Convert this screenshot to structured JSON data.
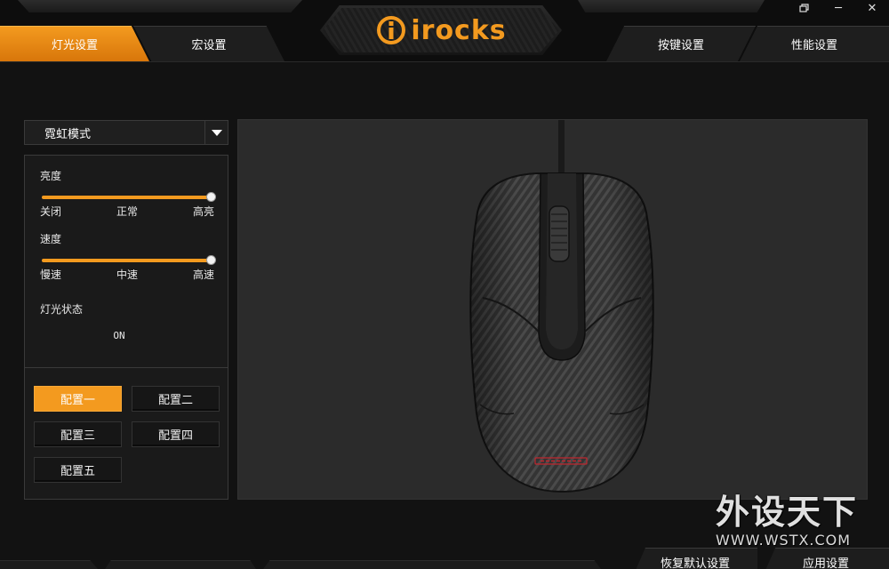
{
  "app": {
    "brand": "irocks"
  },
  "window_controls": {
    "restore_icon": "restore-icon",
    "minimize_label": "─",
    "close_label": "✕"
  },
  "tabs": {
    "lighting": "灯光设置",
    "macro": "宏设置",
    "keys": "按键设置",
    "performance": "性能设置",
    "active": "lighting"
  },
  "lighting": {
    "mode_selected": "霓虹模式",
    "brightness": {
      "label": "亮度",
      "ticks": [
        "关闭",
        "正常",
        "高亮"
      ],
      "value_fraction": 1.0
    },
    "speed": {
      "label": "速度",
      "ticks": [
        "慢速",
        "中速",
        "高速"
      ],
      "value_fraction": 1.0
    },
    "status": {
      "label": "灯光状态",
      "value": "ON"
    }
  },
  "profiles": {
    "items": [
      "配置一",
      "配置二",
      "配置三",
      "配置四",
      "配置五"
    ],
    "active_index": 0
  },
  "bottom": {
    "restore_defaults": "恢复默认设置",
    "apply": "应用设置"
  },
  "watermark": {
    "cn": "外设天下",
    "en": "WWW.WSTX.COM"
  },
  "colors": {
    "accent": "#f39a1f",
    "background": "#121212",
    "panel": "#1a1a1a",
    "preview_bg": "#2b2b2b",
    "mouse_logo": "#c0262e"
  }
}
